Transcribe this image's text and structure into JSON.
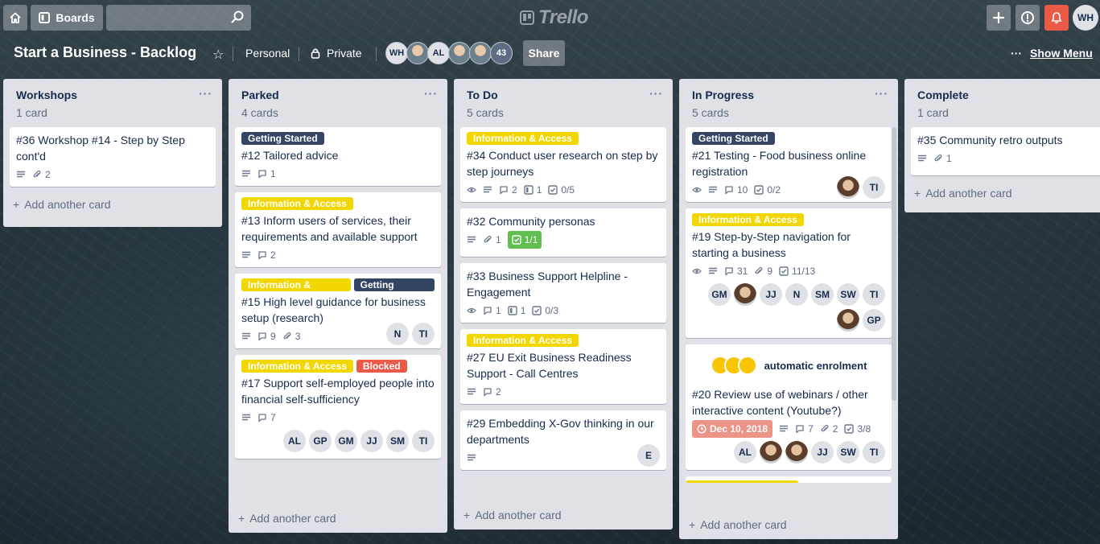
{
  "header": {
    "home_icon": "home-icon",
    "boards_label": "Boards",
    "search_placeholder": "",
    "logo_text": "Trello",
    "me_initials": "WH"
  },
  "board": {
    "title": "Start a Business - Backlog",
    "team": "Personal",
    "visibility": "Private",
    "member_initials": [
      "WH",
      "",
      "AL",
      "",
      ""
    ],
    "member_count": "43",
    "share_label": "Share",
    "menu_label": "Show Menu",
    "menu_dots": "···"
  },
  "colors": {
    "yellow": "#f2d600",
    "dark": "#344563",
    "red": "#eb5a46",
    "green": "#61bd4f"
  },
  "lists": [
    {
      "name": "Workshops",
      "count": "1 card",
      "add": "Add another card",
      "cards": [
        {
          "title": "#36 Workshop #14 - Step by Step cont'd",
          "desc": true,
          "attach": "2"
        }
      ]
    },
    {
      "name": "Parked",
      "count": "4 cards",
      "add": "Add another card",
      "cards": [
        {
          "labels": [
            "Getting Started"
          ],
          "title": "#12 Tailored advice",
          "desc": true,
          "comments": "1"
        },
        {
          "labels": [
            "Information & Access"
          ],
          "title": "#13 Inform users of services, their requirements and available support",
          "desc": true,
          "comments": "2"
        },
        {
          "labels": [
            "Information & Access",
            "Getting Started"
          ],
          "title": "#15 High level guidance for business setup (research)",
          "desc": true,
          "comments": "9",
          "attach": "3",
          "avatars": [
            "N",
            "TI"
          ]
        },
        {
          "labels": [
            "Information & Access",
            "Blocked"
          ],
          "title": "#17 Support self-employed people into financial self-sufficiency",
          "desc": true,
          "comments": "7",
          "avatars": [
            "AL",
            "GP",
            "GM",
            "JJ",
            "SM",
            "TI"
          ]
        }
      ]
    },
    {
      "name": "To Do",
      "count": "5 cards",
      "add": "Add another card",
      "cards": [
        {
          "labels": [
            "Information & Access"
          ],
          "title": "#34 Conduct user research on step by step journeys",
          "watch": true,
          "desc": true,
          "comments": "2",
          "board": "1",
          "checklist": "0/5"
        },
        {
          "title": "#32 Community personas",
          "desc": true,
          "attach": "1",
          "checklist_done": "1/1"
        },
        {
          "title": "#33 Business Support Helpline - Engagement",
          "watch": true,
          "comments": "1",
          "board": "1",
          "checklist": "0/3"
        },
        {
          "labels": [
            "Information & Access"
          ],
          "title": "#27 EU Exit Business Readiness Support - Call Centres",
          "desc": true,
          "comments": "2"
        },
        {
          "title": "#29 Embedding X-Gov thinking in our departments",
          "desc": true,
          "avatars": [
            "E"
          ]
        }
      ]
    },
    {
      "name": "In Progress",
      "count": "5 cards",
      "add": "Add another card",
      "cards": [
        {
          "labels": [
            "Getting Started"
          ],
          "title": "#21 Testing - Food business online registration",
          "watch": true,
          "desc": true,
          "comments": "10",
          "checklist": "0/2",
          "avatars": [
            "photo",
            "TI"
          ]
        },
        {
          "labels": [
            "Information & Access"
          ],
          "title": "#19 Step-by-Step navigation for starting a business",
          "watch": true,
          "desc": true,
          "comments": "31",
          "attach": "9",
          "checklist": "11/13",
          "avatars": [
            "GM",
            "photo",
            "JJ",
            "N",
            "SM",
            "SW",
            "TI",
            "photo",
            "GP"
          ]
        },
        {
          "cover": "automatic enrolment",
          "title": "#20 Review use of webinars / other interactive content (Youtube?)",
          "due": "Dec 10, 2018",
          "desc": true,
          "comments": "7",
          "attach": "2",
          "checklist": "3/8",
          "avatars": [
            "AL",
            "photo",
            "photo",
            "JJ",
            "SW",
            "TI"
          ]
        }
      ]
    },
    {
      "name": "Complete",
      "count": "1 card",
      "add": "Add another card",
      "cards": [
        {
          "title": "#35 Community retro outputs",
          "desc": true,
          "attach": "1"
        }
      ]
    }
  ]
}
